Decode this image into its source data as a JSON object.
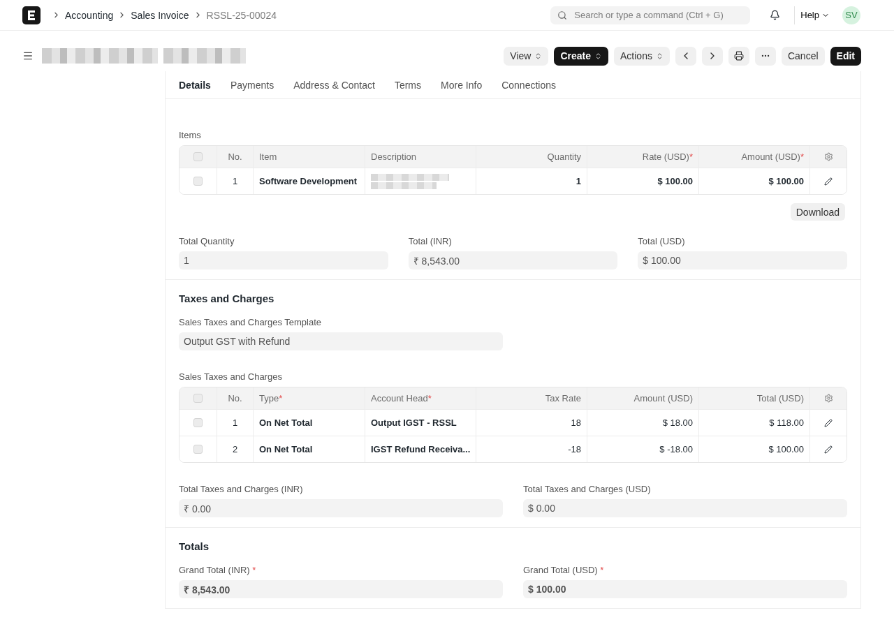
{
  "navbar": {
    "breadcrumbs": [
      "Accounting",
      "Sales Invoice",
      "RSSL-25-00024"
    ],
    "search": {
      "placeholder": "Search or type a command (Ctrl + G)"
    },
    "help": "Help",
    "avatar": "SV"
  },
  "toolbar": {
    "buttons": [
      {
        "kind": "select",
        "label": "View"
      },
      {
        "kind": "primary_select",
        "label": "Create"
      },
      {
        "kind": "select",
        "label": "Actions"
      },
      {
        "kind": "prev"
      },
      {
        "kind": "next"
      },
      {
        "kind": "print"
      },
      {
        "kind": "more"
      },
      {
        "kind": "text",
        "label": "Cancel"
      },
      {
        "kind": "primary_text",
        "label": "Edit"
      }
    ]
  },
  "tabs": [
    {
      "label": "Details",
      "selected": true
    },
    {
      "label": "Payments",
      "selected": false
    },
    {
      "label": "Address & Contact",
      "selected": false
    },
    {
      "label": "Terms",
      "selected": false
    },
    {
      "label": "More Info",
      "selected": false
    },
    {
      "label": "Connections",
      "selected": false
    }
  ],
  "sections": [
    {
      "kind": "items",
      "blocks": [
        {
          "kind": "items_table",
          "label": "Items",
          "all_selected": false,
          "columns": [
            {
              "label": "No."
            },
            {
              "label": "Item"
            },
            {
              "label": "Description"
            },
            {
              "label": "Quantity"
            },
            {
              "label": "Rate (USD)",
              "required_mark": "*"
            },
            {
              "label": "Amount (USD)",
              "required_mark": "*"
            }
          ],
          "rows": [
            {
              "selected": false,
              "cells": [
                "1",
                "Software Development",
                {
                  "kind": "blurred"
                },
                "1",
                "$ 100.00",
                "$ 100.00"
              ]
            }
          ],
          "action": "Download"
        },
        {
          "kind": "fields3",
          "fields": [
            {
              "label": "Total Quantity",
              "value": "1"
            },
            {
              "label": "Total (INR)",
              "value": "₹ 8,543.00"
            },
            {
              "label": "Total (USD)",
              "value": "$ 100.00"
            }
          ]
        }
      ]
    },
    {
      "kind": "taxes",
      "title": "Taxes and Charges",
      "blocks": [
        {
          "kind": "fields2",
          "fields": [
            {
              "label": "Sales Taxes and Charges Template",
              "value": "Output GST with Refund"
            }
          ]
        },
        {
          "kind": "taxes_table",
          "label": "Sales Taxes and Charges",
          "all_selected": false,
          "columns": [
            {
              "label": "No."
            },
            {
              "label": "Type",
              "required_mark": "*"
            },
            {
              "label": "Account Head",
              "required_mark": "*"
            },
            {
              "label": "Tax Rate"
            },
            {
              "label": "Amount (USD)"
            },
            {
              "label": "Total (USD)"
            }
          ],
          "rows": [
            {
              "selected": false,
              "cells": [
                "1",
                "On Net Total",
                "Output IGST - RSSL",
                "18",
                "$ 18.00",
                "$ 118.00"
              ]
            },
            {
              "selected": false,
              "cells": [
                "2",
                "On Net Total",
                "IGST Refund Receiva...",
                "-18",
                "$ -18.00",
                "$ 100.00"
              ]
            }
          ]
        },
        {
          "kind": "fields2",
          "fields": [
            {
              "label": "Total Taxes and Charges (INR)",
              "value": "₹ 0.00"
            },
            {
              "label": "Total Taxes and Charges (USD)",
              "value": "$ 0.00"
            }
          ]
        }
      ]
    },
    {
      "kind": "totals",
      "title": "Totals",
      "blocks": [
        {
          "kind": "totals2",
          "fields": [
            {
              "label": "Grand Total (INR)",
              "required_mark": "*",
              "value": "₹ 8,543.00"
            },
            {
              "label": "Grand Total (USD)",
              "required_mark": "*",
              "value": "$ 100.00"
            }
          ]
        }
      ]
    }
  ]
}
